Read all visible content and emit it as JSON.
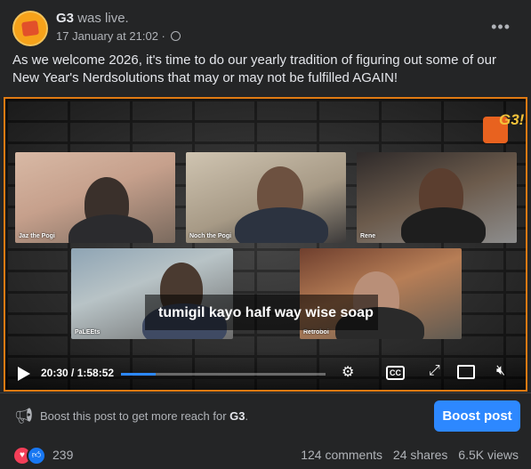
{
  "post": {
    "page_name": "G3",
    "status": "was live.",
    "timestamp": "17 January at 21:02",
    "separator": "·",
    "caption": "As we welcome 2026, it's time to do our yearly tradition of figuring out some of our New Year's Nerdsolutions that may or may not be fulfilled AGAIN!",
    "more_icon": "more-horizontal-icon"
  },
  "video": {
    "participants": [
      "Jaz the Pogi",
      "Noch the Pogi",
      "Rene",
      "PaLEEts",
      "Retroboi"
    ],
    "subtitle": "tumigil kayo half way wise soap",
    "time": "20:30 / 1:58:52",
    "progress": 0.17,
    "accent": "#2d88ff",
    "border_color": "#e07a12"
  },
  "boost": {
    "text_prefix": "Boost this post to get more reach for ",
    "page": "G3",
    "text_suffix": ".",
    "button": "Boost post"
  },
  "engagement": {
    "reaction_count": "239",
    "comments": "124 comments",
    "shares": "24 shares",
    "views": "6.5K views"
  }
}
